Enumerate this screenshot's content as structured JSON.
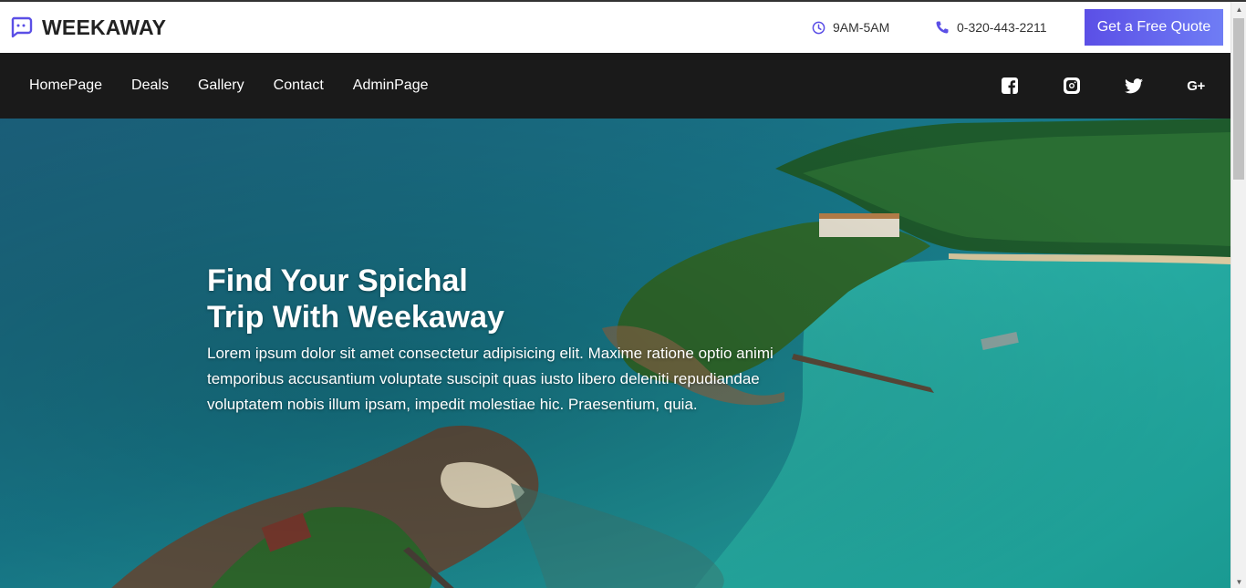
{
  "header": {
    "brand": "WEEKAWAY",
    "hours": "9AM-5AM",
    "phone": "0-320-443-2211",
    "quote_button": "Get a Free Quote"
  },
  "nav": {
    "links": [
      "HomePage",
      "Deals",
      "Gallery",
      "Contact",
      "AdminPage"
    ],
    "socials": [
      "facebook-icon",
      "instagram-icon",
      "twitter-icon",
      "google-plus-icon"
    ],
    "google_plus_label": "G+"
  },
  "hero": {
    "title_line1": "Find Your Spichal",
    "title_line2": "Trip With Weekaway",
    "description": "Lorem ipsum dolor sit amet consectetur adipisicing elit. Maxime ratione optio animi temporibus accusantium voluptate suscipit quas iusto libero deleniti repudiandae voluptatem nobis illum ipsam, impedit molestiae hic. Praesentium, quia."
  },
  "colors": {
    "accent": "#5b4fe6",
    "nav_bg": "#1a1a1a",
    "icon_purple": "#5b4fe6"
  }
}
